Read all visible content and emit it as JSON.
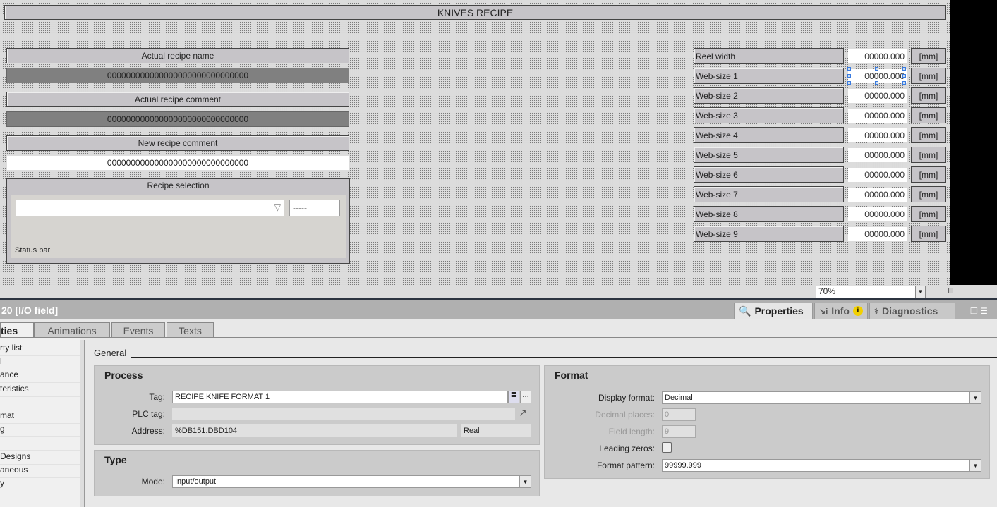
{
  "screen": {
    "title": "KNIVES RECIPE",
    "left": {
      "actual_name_label": "Actual recipe name",
      "actual_name_value": "000000000000000000000000000000",
      "actual_comment_label": "Actual recipe comment",
      "actual_comment_value": "000000000000000000000000000000",
      "new_comment_label": "New recipe comment",
      "new_comment_value": "000000000000000000000000000000",
      "recipe_selection_label": "Recipe selection",
      "recipe_number": "-----",
      "status_bar": "Status bar"
    },
    "rows": [
      {
        "label": "Reel width",
        "value": "00000.000",
        "unit": "[mm]"
      },
      {
        "label": "Web-size 1",
        "value": "00000.000",
        "unit": "[mm]"
      },
      {
        "label": "Web-size 2",
        "value": "00000.000",
        "unit": "[mm]"
      },
      {
        "label": "Web-size 3",
        "value": "00000.000",
        "unit": "[mm]"
      },
      {
        "label": "Web-size 4",
        "value": "00000.000",
        "unit": "[mm]"
      },
      {
        "label": "Web-size 5",
        "value": "00000.000",
        "unit": "[mm]"
      },
      {
        "label": "Web-size 6",
        "value": "00000.000",
        "unit": "[mm]"
      },
      {
        "label": "Web-size 7",
        "value": "00000.000",
        "unit": "[mm]"
      },
      {
        "label": "Web-size 8",
        "value": "00000.000",
        "unit": "[mm]"
      },
      {
        "label": "Web-size 9",
        "value": "00000.000",
        "unit": "[mm]"
      }
    ]
  },
  "zoom": {
    "value": "70%"
  },
  "inspector": {
    "title": "20 [I/O field]",
    "panel_tabs": {
      "properties": "Properties",
      "info": "Info",
      "diagnostics": "Diagnostics"
    },
    "tabs": [
      "ties",
      "Animations",
      "Events",
      "Texts"
    ],
    "nav": [
      "rty list",
      "l",
      "ance",
      "teristics",
      "",
      "mat",
      "g",
      "",
      "Designs",
      "aneous",
      "y"
    ],
    "section": "General",
    "process": {
      "title": "Process",
      "tag_label": "Tag:",
      "tag_value": "RECIPE KNIFE FORMAT 1",
      "plc_label": "PLC tag:",
      "plc_value": "",
      "address_label": "Address:",
      "address_value": "%DB151.DBD104",
      "type_value": "Real"
    },
    "type": {
      "title": "Type",
      "mode_label": "Mode:",
      "mode_value": "Input/output"
    },
    "format": {
      "title": "Format",
      "display_label": "Display format:",
      "display_value": "Decimal",
      "decimal_label": "Decimal places:",
      "decimal_value": "0",
      "length_label": "Field length:",
      "length_value": "9",
      "leading_label": "Leading zeros:",
      "leading_checked": false,
      "pattern_label": "Format pattern:",
      "pattern_value": "99999.999"
    }
  }
}
